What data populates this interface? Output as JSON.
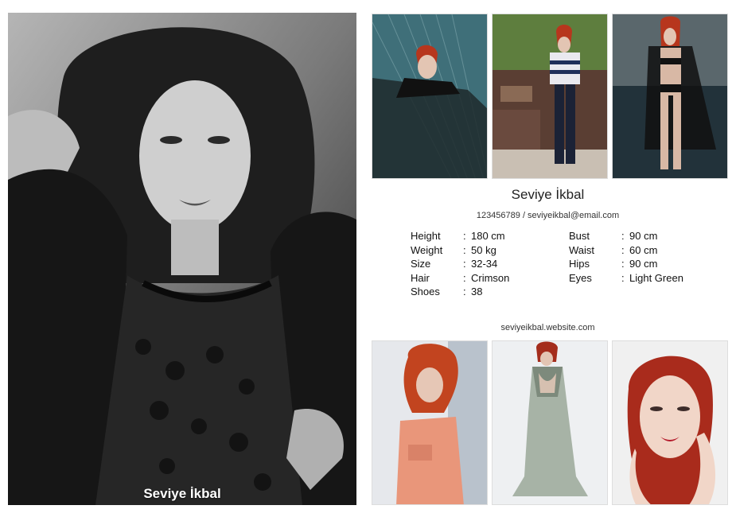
{
  "model": {
    "name": "Seviye İkbal",
    "contact": "123456789 / seviyeikbal@email.com",
    "website": "seviyeikbal.website.com"
  },
  "stats_left": [
    {
      "label": "Height",
      "value": "180 cm"
    },
    {
      "label": "Weight",
      "value": "50 kg"
    },
    {
      "label": "Size",
      "value": "32-34"
    },
    {
      "label": "Hair",
      "value": "Crimson"
    },
    {
      "label": "Shoes",
      "value": "38"
    }
  ],
  "stats_right": [
    {
      "label": "Bust",
      "value": "90 cm"
    },
    {
      "label": "Waist",
      "value": "60 cm"
    },
    {
      "label": "Hips",
      "value": "90 cm"
    },
    {
      "label": "Eyes",
      "value": "Light Green"
    }
  ],
  "separator": ":",
  "colors": {
    "hair": "#b7361d",
    "teal_bg": "#3f6f79",
    "bw_bg": "#8a8a8a"
  }
}
